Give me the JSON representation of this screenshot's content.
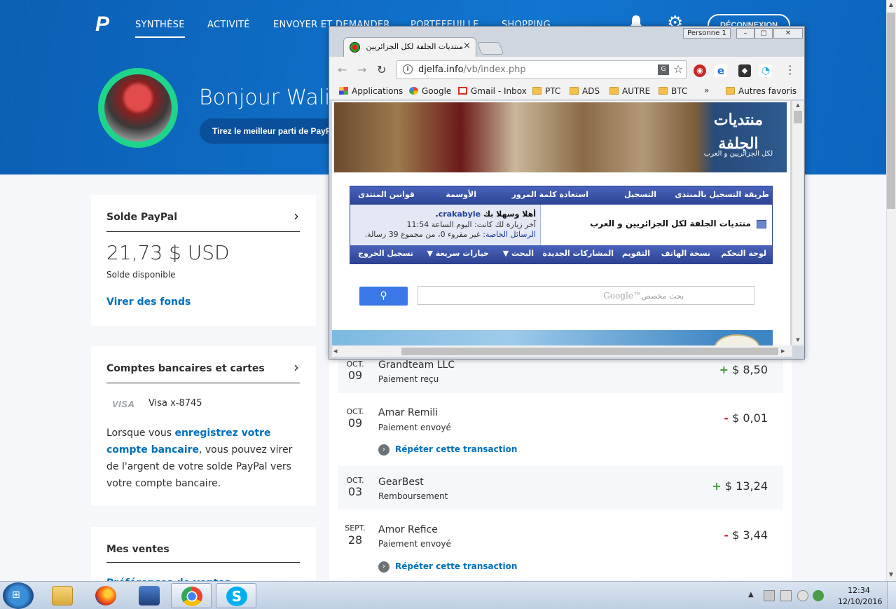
{
  "paypal": {
    "logo": "P",
    "nav": [
      "SYNTHÈSE",
      "ACTIVITÉ",
      "ENVOYER ET DEMANDER",
      "PORTEFEUILLE",
      "SHOPPING"
    ],
    "logout": "DÉCONNEXION",
    "greeting": "Bonjour Walid",
    "promo": "Tirez le meilleur parti de PayPal",
    "balance_card": {
      "title": "Solde PayPal",
      "amount": "21,73 $ USD",
      "sub": "Solde disponible",
      "link": "Virer des fonds"
    },
    "bank_card": {
      "title": "Comptes bancaires et cartes",
      "visa_logo": "VISA",
      "visa_text": "Visa x-8745",
      "desc_1": "Lorsque vous ",
      "desc_link": "enregistrez votre compte bancaire",
      "desc_2": ", vous pouvez virer de l'argent de votre solde PayPal vers votre compte bancaire."
    },
    "sales_card": {
      "title": "Mes ventes",
      "sub": "Préférences de ventes"
    },
    "transactions": [
      {
        "mon": "OCT.",
        "day": "09",
        "name": "Grandteam LLC",
        "type": "Paiement reçu",
        "sign": "+",
        "amount": "$ 8,50"
      },
      {
        "mon": "OCT.",
        "day": "09",
        "name": "Amar Remili",
        "type": "Paiement envoyé",
        "sign": "-",
        "amount": "$ 0,01",
        "repeat": "Répéter cette transaction"
      },
      {
        "mon": "OCT.",
        "day": "03",
        "name": "GearBest",
        "type": "Remboursement",
        "sign": "+",
        "amount": "$ 13,24"
      },
      {
        "mon": "SEPT.",
        "day": "28",
        "name": "Amor Refice",
        "type": "Paiement envoyé",
        "sign": "-",
        "amount": "$ 3,44",
        "repeat": "Répéter cette transaction"
      }
    ]
  },
  "chrome": {
    "person": "Personne 1",
    "tab_title": "منتديات الجلفة لكل الجزائريين و",
    "url_host": "djelfa.info",
    "url_path": "/vb/index.php",
    "bookmarks": [
      "Applications",
      "Google",
      "Gmail - Inbox",
      "PTC",
      "ADS",
      "AUTRE",
      "BTC"
    ],
    "bookmarks_more": "»",
    "other_bookmarks": "Autres favoris"
  },
  "forum": {
    "banner_title": "منتديات الجلفة",
    "banner_sub": "لكل الجزائريين و العرب",
    "top_links": [
      "طريقة التسجيل بالمنتدى",
      "التسجيل",
      "استعادة كلمة المرور",
      "الأوسمة",
      "قوانين المنتدى"
    ],
    "forum_name": "منتديات الجلفة لكل الجزائريين و العرب",
    "welcome": "أهلا وسهلا بك",
    "username": "crakabyle",
    "last_visit": "آخر زيارة لك كانت: اليوم الساعة 11:54",
    "pm_label": "الرسائل الخاصة:",
    "pm_text": "غير مقروء 0، من مجموع 39 رسالة.",
    "bottom_links": [
      "لوحة التحكم",
      "نسخة الهاتف",
      "التقويم",
      "المشاركات الجديدة",
      "البحث",
      "خيارات سريعة",
      "تسجيل الخروج"
    ],
    "search_placeholder": "بحث مخصص",
    "search_brand": "Google™"
  },
  "taskbar": {
    "time": "12:34",
    "date": "12/10/2016"
  }
}
